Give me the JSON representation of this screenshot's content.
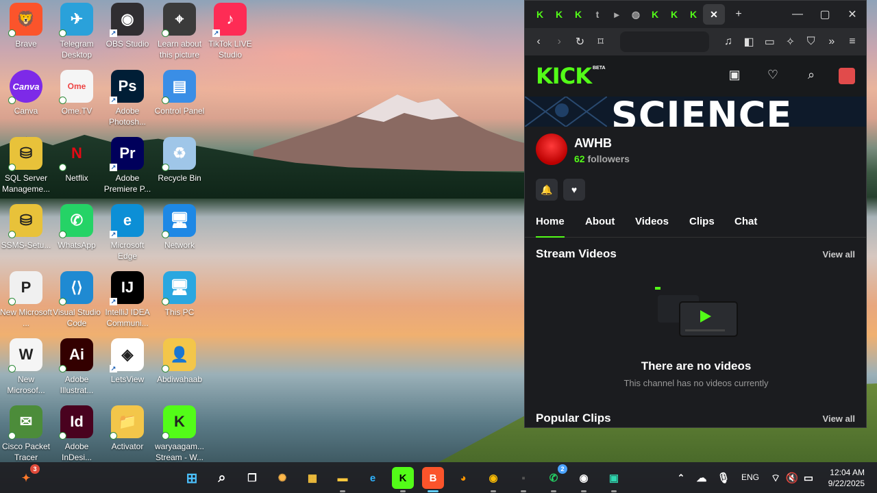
{
  "desktop": {
    "icons": [
      {
        "label": "Brave",
        "glyph": "🦁",
        "bg": "#fb542b"
      },
      {
        "label": "Telegram Desktop",
        "glyph": "✈",
        "bg": "#2aa1da"
      },
      {
        "label": "OBS Studio",
        "glyph": "◉",
        "bg": "#302e31"
      },
      {
        "label": "Learn about this picture",
        "glyph": "⌖",
        "bg": "#3b3b3b"
      },
      {
        "label": "TikTok LIVE Studio",
        "glyph": "♪",
        "bg": "#fe2c55"
      },
      {
        "label": "Canva",
        "glyph": "Canva",
        "bg": "#7d2ae8"
      },
      {
        "label": "Ome.TV",
        "glyph": "Ome",
        "bg": "#f5f5f5"
      },
      {
        "label": "Adobe Photosh...",
        "glyph": "Ps",
        "bg": "#001e36"
      },
      {
        "label": "Control Panel",
        "glyph": "▤",
        "bg": "#3a8ee6"
      },
      {
        "label": "SQL Server Manageme...",
        "glyph": "⛁",
        "bg": "#e8c23a"
      },
      {
        "label": "Netflix",
        "glyph": "N",
        "bg": "transparent"
      },
      {
        "label": "Adobe Premiere P...",
        "glyph": "Pr",
        "bg": "#00005b"
      },
      {
        "label": "Recycle Bin",
        "glyph": "♻",
        "bg": "#9fc6e8"
      },
      {
        "label": "SSMS-Setu...",
        "glyph": "⛁",
        "bg": "#e8c23a"
      },
      {
        "label": "WhatsApp",
        "glyph": "✆",
        "bg": "#25d366"
      },
      {
        "label": "Microsoft Edge",
        "glyph": "e",
        "bg": "#0c8fd6"
      },
      {
        "label": "Network",
        "glyph": "🖥",
        "bg": "#1e88e5"
      },
      {
        "label": "New Microsoft ...",
        "glyph": "P",
        "bg": "#f0f0f0"
      },
      {
        "label": "Visual Studio Code",
        "glyph": "⟨⟩",
        "bg": "#1f8ad2"
      },
      {
        "label": "IntelliJ IDEA Communi...",
        "glyph": "IJ",
        "bg": "#000"
      },
      {
        "label": "This PC",
        "glyph": "🖥",
        "bg": "#2aa7e0"
      },
      {
        "label": "New Microsof...",
        "glyph": "W",
        "bg": "#f5f5f5"
      },
      {
        "label": "Adobe Illustrat...",
        "glyph": "Ai",
        "bg": "#330000"
      },
      {
        "label": "LetsView",
        "glyph": "◈",
        "bg": "#ffffff"
      },
      {
        "label": "Abdiwahaab",
        "glyph": "👤",
        "bg": "#f3c64a"
      },
      {
        "label": "Cisco Packet Tracer",
        "glyph": "✉",
        "bg": "#4c8c3a"
      },
      {
        "label": "Adobe InDesi...",
        "glyph": "Id",
        "bg": "#49021f"
      },
      {
        "label": "Activator",
        "glyph": "📁",
        "bg": "#f3c64a"
      },
      {
        "label": "waryaagam... Stream - W...",
        "glyph": "K",
        "bg": "#53fc18"
      }
    ]
  },
  "browser": {
    "tabs": [
      "K",
      "K",
      "K",
      "t",
      "▸",
      "◍",
      "K",
      "K",
      "K"
    ],
    "active_tab_close": "✕",
    "new_tab": "+",
    "window_controls": {
      "minimize": "—",
      "maximize": "▢",
      "close": "✕"
    },
    "kick": {
      "logo": "KICK",
      "beta": "BETA",
      "banner_text": "SCIENCE",
      "channel_name": "AWHB",
      "followers_count": "62",
      "followers_label": "followers",
      "tabs": [
        "Home",
        "About",
        "Videos",
        "Clips",
        "Chat"
      ],
      "stream_videos_title": "Stream Videos",
      "view_all_1": "View all",
      "empty_title": "There are no videos",
      "empty_subtitle": "This channel has no videos currently",
      "popular_clips_title": "Popular Clips",
      "view_all_2": "View all"
    }
  },
  "taskbar": {
    "notification_badge": "3",
    "whatsapp_badge": "2",
    "language": "ENG",
    "time": "12:04 AM",
    "date": "9/22/2025"
  },
  "colors": {
    "kick_green": "#53fc18",
    "accent": "#60cdff"
  }
}
